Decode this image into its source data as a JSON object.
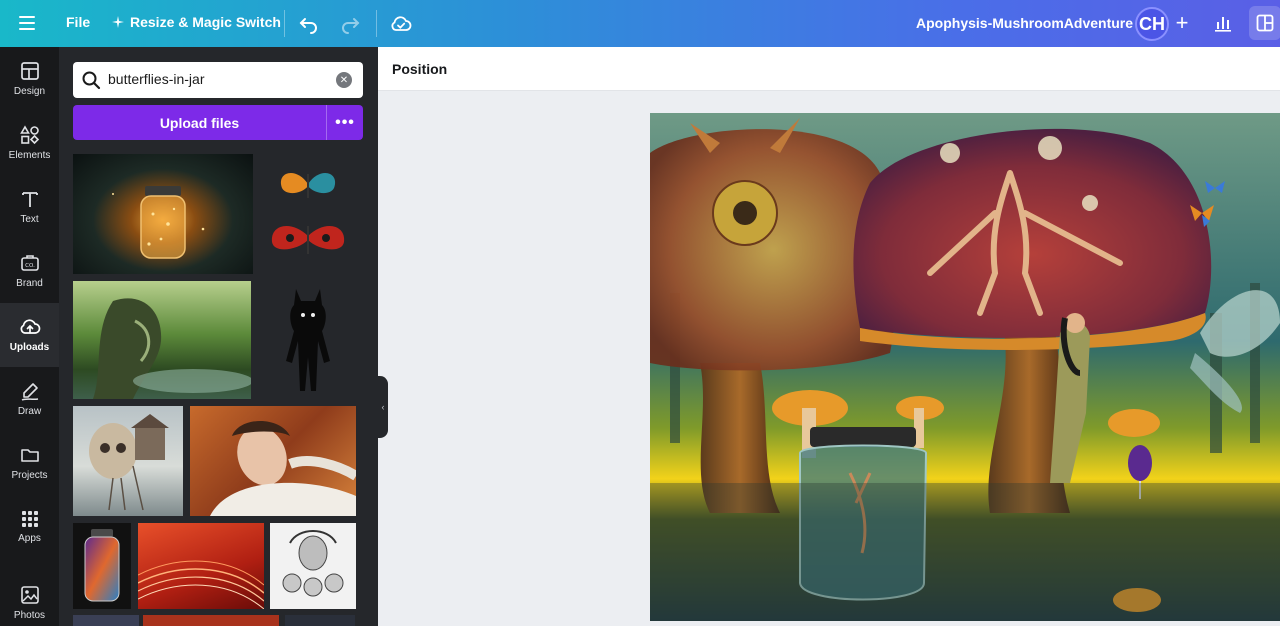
{
  "topbar": {
    "file_label": "File",
    "resize_label": "Resize & Magic Switch",
    "title": "Apophysis-MushroomAdventure",
    "avatar_initials": "CH",
    "gradient": [
      "#19b8c9",
      "#5a5fe6"
    ]
  },
  "rail": {
    "items": [
      {
        "label": "Design",
        "icon": "layout-icon"
      },
      {
        "label": "Elements",
        "icon": "shapes-icon"
      },
      {
        "label": "Text",
        "icon": "text-icon"
      },
      {
        "label": "Brand",
        "icon": "brand-icon"
      },
      {
        "label": "Uploads",
        "icon": "cloud-upload-icon",
        "active": true
      },
      {
        "label": "Draw",
        "icon": "pen-icon"
      },
      {
        "label": "Projects",
        "icon": "folder-icon"
      },
      {
        "label": "Apps",
        "icon": "grid-icon"
      },
      {
        "label": "Photos",
        "icon": "image-icon"
      }
    ]
  },
  "panel": {
    "search_value": "butterflies-in-jar",
    "upload_label": "Upload files",
    "more_label": "•••",
    "accent": "#7d2ae8"
  },
  "context_bar": {
    "position_label": "Position"
  }
}
